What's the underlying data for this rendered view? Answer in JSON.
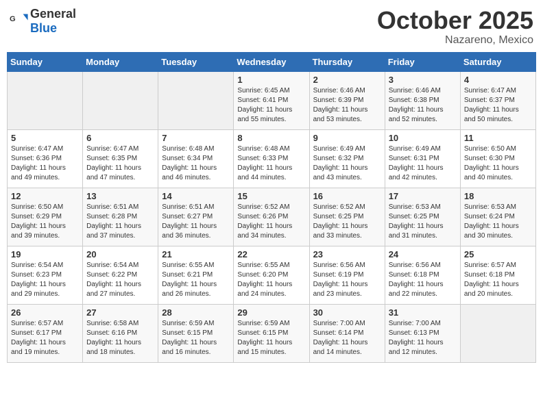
{
  "header": {
    "logo_general": "General",
    "logo_blue": "Blue",
    "month": "October 2025",
    "location": "Nazareno, Mexico"
  },
  "weekdays": [
    "Sunday",
    "Monday",
    "Tuesday",
    "Wednesday",
    "Thursday",
    "Friday",
    "Saturday"
  ],
  "weeks": [
    [
      {
        "day": "",
        "info": ""
      },
      {
        "day": "",
        "info": ""
      },
      {
        "day": "",
        "info": ""
      },
      {
        "day": "1",
        "info": "Sunrise: 6:45 AM\nSunset: 6:41 PM\nDaylight: 11 hours\nand 55 minutes."
      },
      {
        "day": "2",
        "info": "Sunrise: 6:46 AM\nSunset: 6:39 PM\nDaylight: 11 hours\nand 53 minutes."
      },
      {
        "day": "3",
        "info": "Sunrise: 6:46 AM\nSunset: 6:38 PM\nDaylight: 11 hours\nand 52 minutes."
      },
      {
        "day": "4",
        "info": "Sunrise: 6:47 AM\nSunset: 6:37 PM\nDaylight: 11 hours\nand 50 minutes."
      }
    ],
    [
      {
        "day": "5",
        "info": "Sunrise: 6:47 AM\nSunset: 6:36 PM\nDaylight: 11 hours\nand 49 minutes."
      },
      {
        "day": "6",
        "info": "Sunrise: 6:47 AM\nSunset: 6:35 PM\nDaylight: 11 hours\nand 47 minutes."
      },
      {
        "day": "7",
        "info": "Sunrise: 6:48 AM\nSunset: 6:34 PM\nDaylight: 11 hours\nand 46 minutes."
      },
      {
        "day": "8",
        "info": "Sunrise: 6:48 AM\nSunset: 6:33 PM\nDaylight: 11 hours\nand 44 minutes."
      },
      {
        "day": "9",
        "info": "Sunrise: 6:49 AM\nSunset: 6:32 PM\nDaylight: 11 hours\nand 43 minutes."
      },
      {
        "day": "10",
        "info": "Sunrise: 6:49 AM\nSunset: 6:31 PM\nDaylight: 11 hours\nand 42 minutes."
      },
      {
        "day": "11",
        "info": "Sunrise: 6:50 AM\nSunset: 6:30 PM\nDaylight: 11 hours\nand 40 minutes."
      }
    ],
    [
      {
        "day": "12",
        "info": "Sunrise: 6:50 AM\nSunset: 6:29 PM\nDaylight: 11 hours\nand 39 minutes."
      },
      {
        "day": "13",
        "info": "Sunrise: 6:51 AM\nSunset: 6:28 PM\nDaylight: 11 hours\nand 37 minutes."
      },
      {
        "day": "14",
        "info": "Sunrise: 6:51 AM\nSunset: 6:27 PM\nDaylight: 11 hours\nand 36 minutes."
      },
      {
        "day": "15",
        "info": "Sunrise: 6:52 AM\nSunset: 6:26 PM\nDaylight: 11 hours\nand 34 minutes."
      },
      {
        "day": "16",
        "info": "Sunrise: 6:52 AM\nSunset: 6:25 PM\nDaylight: 11 hours\nand 33 minutes."
      },
      {
        "day": "17",
        "info": "Sunrise: 6:53 AM\nSunset: 6:25 PM\nDaylight: 11 hours\nand 31 minutes."
      },
      {
        "day": "18",
        "info": "Sunrise: 6:53 AM\nSunset: 6:24 PM\nDaylight: 11 hours\nand 30 minutes."
      }
    ],
    [
      {
        "day": "19",
        "info": "Sunrise: 6:54 AM\nSunset: 6:23 PM\nDaylight: 11 hours\nand 29 minutes."
      },
      {
        "day": "20",
        "info": "Sunrise: 6:54 AM\nSunset: 6:22 PM\nDaylight: 11 hours\nand 27 minutes."
      },
      {
        "day": "21",
        "info": "Sunrise: 6:55 AM\nSunset: 6:21 PM\nDaylight: 11 hours\nand 26 minutes."
      },
      {
        "day": "22",
        "info": "Sunrise: 6:55 AM\nSunset: 6:20 PM\nDaylight: 11 hours\nand 24 minutes."
      },
      {
        "day": "23",
        "info": "Sunrise: 6:56 AM\nSunset: 6:19 PM\nDaylight: 11 hours\nand 23 minutes."
      },
      {
        "day": "24",
        "info": "Sunrise: 6:56 AM\nSunset: 6:18 PM\nDaylight: 11 hours\nand 22 minutes."
      },
      {
        "day": "25",
        "info": "Sunrise: 6:57 AM\nSunset: 6:18 PM\nDaylight: 11 hours\nand 20 minutes."
      }
    ],
    [
      {
        "day": "26",
        "info": "Sunrise: 6:57 AM\nSunset: 6:17 PM\nDaylight: 11 hours\nand 19 minutes."
      },
      {
        "day": "27",
        "info": "Sunrise: 6:58 AM\nSunset: 6:16 PM\nDaylight: 11 hours\nand 18 minutes."
      },
      {
        "day": "28",
        "info": "Sunrise: 6:59 AM\nSunset: 6:15 PM\nDaylight: 11 hours\nand 16 minutes."
      },
      {
        "day": "29",
        "info": "Sunrise: 6:59 AM\nSunset: 6:15 PM\nDaylight: 11 hours\nand 15 minutes."
      },
      {
        "day": "30",
        "info": "Sunrise: 7:00 AM\nSunset: 6:14 PM\nDaylight: 11 hours\nand 14 minutes."
      },
      {
        "day": "31",
        "info": "Sunrise: 7:00 AM\nSunset: 6:13 PM\nDaylight: 11 hours\nand 12 minutes."
      },
      {
        "day": "",
        "info": ""
      }
    ]
  ]
}
